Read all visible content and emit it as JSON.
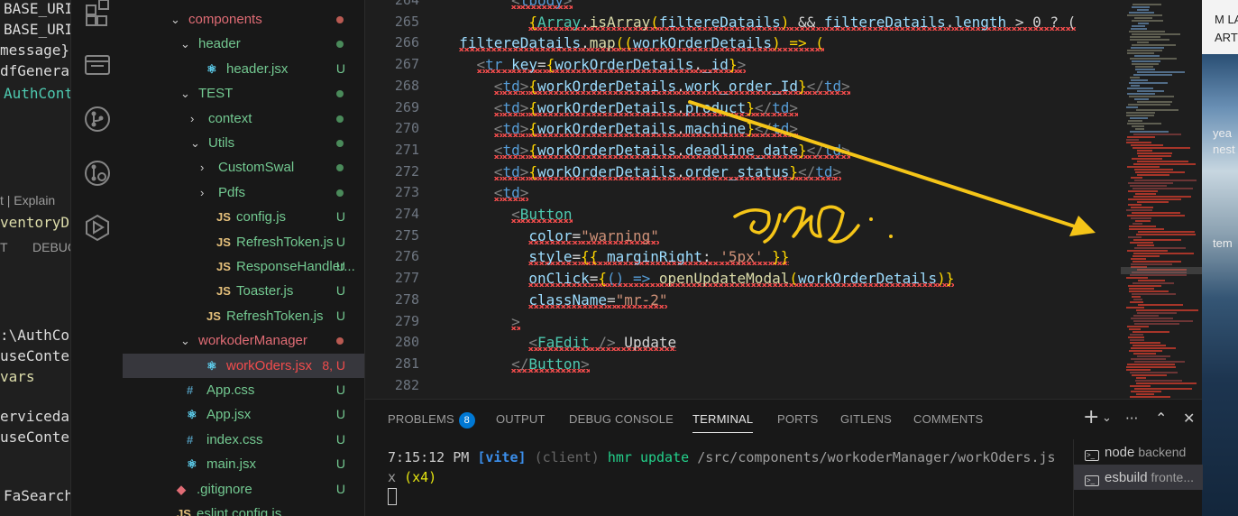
{
  "background_left": {
    "lines": [
      {
        "text": "BASE_URI",
        "color": "#dcdcdc"
      },
      {
        "text": "BASE_URI",
        "color": "#dcdcdc"
      },
      {
        "text": "message}",
        "color": "#dcdcdc"
      },
      {
        "text": "dfGenerat",
        "color": "#dcdcdc"
      },
      {
        "text": "AuthCont",
        "color": "#4ec9b0"
      },
      {
        "text": "t | Explain",
        "color": "#9d9d9d"
      },
      {
        "text": "ventoryDe",
        "color": "#dcdcaa"
      },
      {
        "text": "T",
        "color": "#9d9d9d"
      },
      {
        "text": "DEBUG",
        "color": "#9d9d9d"
      },
      {
        "text": ":\\AuthCon",
        "color": "#dcdcdc"
      },
      {
        "text": "useContex",
        "color": "#dcdcdc"
      },
      {
        "text": "vars",
        "color": "#dcdcaa"
      },
      {
        "text": "ervicedata",
        "color": "#dcdcdc"
      },
      {
        "text": "useConte",
        "color": "#dcdcdc"
      },
      {
        "text": "FaSearch",
        "color": "#dcdcdc"
      }
    ]
  },
  "activity_bar": {
    "icons": [
      "extensions-icon",
      "remote-explorer-icon",
      "source-control-icon",
      "git-graph-icon",
      "live-share-icon"
    ]
  },
  "explorer": {
    "rows": [
      {
        "name": "components",
        "type": "folder",
        "open": true,
        "depth": 1,
        "color": "#e06c75",
        "status": "dot",
        "status_color": "#b95a52"
      },
      {
        "name": "header",
        "type": "folder",
        "open": true,
        "depth": 2,
        "color": "#73c991",
        "status": "dot",
        "status_color": "#4a8a5a"
      },
      {
        "name": "header.jsx",
        "type": "jsx",
        "depth": 3,
        "color": "#73c991",
        "status": "U"
      },
      {
        "name": "TEST",
        "type": "folder",
        "open": true,
        "depth": 2,
        "color": "#73c991",
        "status": "dot",
        "status_color": "#4a8a5a"
      },
      {
        "name": "context",
        "type": "folder",
        "open": false,
        "depth": 3,
        "color": "#73c991",
        "status": "dot",
        "status_color": "#4a8a5a"
      },
      {
        "name": "Utils",
        "type": "folder",
        "open": true,
        "depth": 3,
        "color": "#73c991",
        "status": "dot",
        "status_color": "#4a8a5a"
      },
      {
        "name": "CustomSwal",
        "type": "folder",
        "open": false,
        "depth": 4,
        "color": "#73c991",
        "status": "dot",
        "status_color": "#4a8a5a"
      },
      {
        "name": "Pdfs",
        "type": "folder",
        "open": false,
        "depth": 4,
        "color": "#73c991",
        "status": "dot",
        "status_color": "#4a8a5a"
      },
      {
        "name": "config.js",
        "type": "js",
        "depth": 4,
        "color": "#73c991",
        "status": "U"
      },
      {
        "name": "RefreshToken.js",
        "type": "js",
        "depth": 4,
        "color": "#73c991",
        "status": "U"
      },
      {
        "name": "ResponseHandler...",
        "type": "js",
        "depth": 4,
        "color": "#73c991",
        "status": "U"
      },
      {
        "name": "Toaster.js",
        "type": "js",
        "depth": 4,
        "color": "#73c991",
        "status": "U"
      },
      {
        "name": "RefreshToken.js",
        "type": "js",
        "depth": 3,
        "color": "#73c991",
        "status": "U"
      },
      {
        "name": "workoderManager",
        "type": "folder",
        "open": true,
        "depth": 2,
        "color": "#e06c75",
        "status": "dot",
        "status_color": "#b95a52"
      },
      {
        "name": "workOders.jsx",
        "type": "jsx",
        "depth": 3,
        "color": "#f14c4c",
        "status": "8, U",
        "status_color": "#f14c4c",
        "selected": true
      },
      {
        "name": "App.css",
        "type": "css",
        "depth": 1,
        "color": "#73c991",
        "status": "U"
      },
      {
        "name": "App.jsx",
        "type": "jsx",
        "depth": 1,
        "color": "#73c991",
        "status": "U"
      },
      {
        "name": "index.css",
        "type": "css",
        "depth": 1,
        "color": "#73c991",
        "status": "U"
      },
      {
        "name": "main.jsx",
        "type": "jsx",
        "depth": 1,
        "color": "#73c991",
        "status": "U"
      },
      {
        "name": ".gitignore",
        "type": "git",
        "depth": 0,
        "color": "#73c991",
        "status": "U"
      },
      {
        "name": "eslint.config.js",
        "type": "js",
        "depth": 0,
        "color": "#73c991",
        "status": ""
      }
    ]
  },
  "editor": {
    "line_numbers": [
      "264",
      "265",
      "266",
      "267",
      "268",
      "269",
      "270",
      "271",
      "272",
      "273",
      "274",
      "275",
      "276",
      "277",
      "278",
      "279",
      "280",
      "281",
      "282"
    ],
    "lines": [
      [
        {
          "t": "        ",
          "c": "k-txt"
        },
        {
          "t": "<",
          "c": "k-punc"
        },
        {
          "t": "tbody",
          "c": "k-tag"
        },
        {
          "t": ">",
          "c": "k-punc"
        }
      ],
      [
        {
          "t": "          ",
          "c": "k-txt"
        },
        {
          "t": "{",
          "c": "k-brace"
        },
        {
          "t": "Array",
          "c": "k-comp"
        },
        {
          "t": ".",
          "c": "k-txt"
        },
        {
          "t": "isArray",
          "c": "k-fn"
        },
        {
          "t": "(",
          "c": "k-brace"
        },
        {
          "t": "filtereDatails",
          "c": "k-var"
        },
        {
          "t": ")",
          "c": "k-brace"
        },
        {
          "t": " && ",
          "c": "k-txt"
        },
        {
          "t": "filtereDatails",
          "c": "k-var"
        },
        {
          "t": ".",
          "c": "k-txt"
        },
        {
          "t": "length",
          "c": "k-prop"
        },
        {
          "t": " > 0 ? (",
          "c": "k-txt"
        }
      ],
      [
        {
          "t": "  ",
          "c": "k-txt"
        },
        {
          "t": "filtereDatails",
          "c": "k-var"
        },
        {
          "t": ".",
          "c": "k-txt"
        },
        {
          "t": "map",
          "c": "k-fn"
        },
        {
          "t": "((",
          "c": "k-brace"
        },
        {
          "t": "workOrderDetails",
          "c": "k-var"
        },
        {
          "t": ") => (",
          "c": "k-brace"
        }
      ],
      [
        {
          "t": "    ",
          "c": "k-txt"
        },
        {
          "t": "<",
          "c": "k-punc"
        },
        {
          "t": "tr",
          "c": "k-tag"
        },
        {
          "t": " ",
          "c": "k-txt"
        },
        {
          "t": "key",
          "c": "k-attr"
        },
        {
          "t": "=",
          "c": "k-txt"
        },
        {
          "t": "{",
          "c": "k-brace"
        },
        {
          "t": "workOrderDetails",
          "c": "k-var"
        },
        {
          "t": ".",
          "c": "k-txt"
        },
        {
          "t": "_id",
          "c": "k-prop"
        },
        {
          "t": "}",
          "c": "k-brace"
        },
        {
          "t": ">",
          "c": "k-punc"
        }
      ],
      [
        {
          "t": "      ",
          "c": "k-txt"
        },
        {
          "t": "<",
          "c": "k-punc"
        },
        {
          "t": "td",
          "c": "k-tag"
        },
        {
          "t": ">",
          "c": "k-punc"
        },
        {
          "t": "{",
          "c": "k-brace"
        },
        {
          "t": "workOrderDetails",
          "c": "k-var"
        },
        {
          "t": ".",
          "c": "k-txt"
        },
        {
          "t": "work_order_Id",
          "c": "k-prop"
        },
        {
          "t": "}",
          "c": "k-brace"
        },
        {
          "t": "</",
          "c": "k-punc"
        },
        {
          "t": "td",
          "c": "k-tag"
        },
        {
          "t": ">",
          "c": "k-punc"
        }
      ],
      [
        {
          "t": "      ",
          "c": "k-txt"
        },
        {
          "t": "<",
          "c": "k-punc"
        },
        {
          "t": "td",
          "c": "k-tag"
        },
        {
          "t": ">",
          "c": "k-punc"
        },
        {
          "t": "{",
          "c": "k-brace"
        },
        {
          "t": "workOrderDetails",
          "c": "k-var"
        },
        {
          "t": ".",
          "c": "k-txt"
        },
        {
          "t": "product",
          "c": "k-prop"
        },
        {
          "t": "}",
          "c": "k-brace"
        },
        {
          "t": "</",
          "c": "k-punc"
        },
        {
          "t": "td",
          "c": "k-tag"
        },
        {
          "t": ">",
          "c": "k-punc"
        }
      ],
      [
        {
          "t": "      ",
          "c": "k-txt"
        },
        {
          "t": "<",
          "c": "k-punc"
        },
        {
          "t": "td",
          "c": "k-tag"
        },
        {
          "t": ">",
          "c": "k-punc"
        },
        {
          "t": "{",
          "c": "k-brace"
        },
        {
          "t": "workOrderDetails",
          "c": "k-var"
        },
        {
          "t": ".",
          "c": "k-txt"
        },
        {
          "t": "machine",
          "c": "k-prop"
        },
        {
          "t": "}",
          "c": "k-brace"
        },
        {
          "t": "</",
          "c": "k-punc"
        },
        {
          "t": "td",
          "c": "k-tag"
        },
        {
          "t": ">",
          "c": "k-punc"
        }
      ],
      [
        {
          "t": "      ",
          "c": "k-txt"
        },
        {
          "t": "<",
          "c": "k-punc"
        },
        {
          "t": "td",
          "c": "k-tag"
        },
        {
          "t": ">",
          "c": "k-punc"
        },
        {
          "t": "{",
          "c": "k-brace"
        },
        {
          "t": "workOrderDetails",
          "c": "k-var"
        },
        {
          "t": ".",
          "c": "k-txt"
        },
        {
          "t": "deadline_date",
          "c": "k-prop"
        },
        {
          "t": "}",
          "c": "k-brace"
        },
        {
          "t": "</",
          "c": "k-punc"
        },
        {
          "t": "td",
          "c": "k-tag"
        },
        {
          "t": ">",
          "c": "k-punc"
        }
      ],
      [
        {
          "t": "      ",
          "c": "k-txt"
        },
        {
          "t": "<",
          "c": "k-punc"
        },
        {
          "t": "td",
          "c": "k-tag"
        },
        {
          "t": ">",
          "c": "k-punc"
        },
        {
          "t": "{",
          "c": "k-brace"
        },
        {
          "t": "workOrderDetails",
          "c": "k-var"
        },
        {
          "t": ".",
          "c": "k-txt"
        },
        {
          "t": "order_status",
          "c": "k-prop"
        },
        {
          "t": "}",
          "c": "k-brace"
        },
        {
          "t": "</",
          "c": "k-punc"
        },
        {
          "t": "td",
          "c": "k-tag"
        },
        {
          "t": ">",
          "c": "k-punc"
        }
      ],
      [
        {
          "t": "      ",
          "c": "k-txt"
        },
        {
          "t": "<",
          "c": "k-punc"
        },
        {
          "t": "td",
          "c": "k-tag"
        },
        {
          "t": ">",
          "c": "k-punc"
        }
      ],
      [
        {
          "t": "        ",
          "c": "k-txt"
        },
        {
          "t": "<",
          "c": "k-punc"
        },
        {
          "t": "Button",
          "c": "k-comp"
        }
      ],
      [
        {
          "t": "          ",
          "c": "k-txt"
        },
        {
          "t": "color",
          "c": "k-attr"
        },
        {
          "t": "=",
          "c": "k-txt"
        },
        {
          "t": "\"warning\"",
          "c": "k-str"
        }
      ],
      [
        {
          "t": "          ",
          "c": "k-txt"
        },
        {
          "t": "style",
          "c": "k-attr"
        },
        {
          "t": "=",
          "c": "k-txt"
        },
        {
          "t": "{{",
          "c": "k-brace"
        },
        {
          "t": " ",
          "c": "k-txt"
        },
        {
          "t": "marginRight",
          "c": "k-prop"
        },
        {
          "t": ": ",
          "c": "k-txt"
        },
        {
          "t": "'5px'",
          "c": "k-str"
        },
        {
          "t": " ",
          "c": "k-txt"
        },
        {
          "t": "}}",
          "c": "k-brace"
        }
      ],
      [
        {
          "t": "          ",
          "c": "k-txt"
        },
        {
          "t": "onClick",
          "c": "k-attr"
        },
        {
          "t": "=",
          "c": "k-txt"
        },
        {
          "t": "{",
          "c": "k-brace"
        },
        {
          "t": "() => ",
          "c": "k-tag"
        },
        {
          "t": "openUpdateModal",
          "c": "k-fn"
        },
        {
          "t": "(",
          "c": "k-brace"
        },
        {
          "t": "workOrderDetails",
          "c": "k-var"
        },
        {
          "t": ")",
          "c": "k-brace"
        },
        {
          "t": "}",
          "c": "k-brace"
        }
      ],
      [
        {
          "t": "          ",
          "c": "k-txt"
        },
        {
          "t": "className",
          "c": "k-attr"
        },
        {
          "t": "=",
          "c": "k-txt"
        },
        {
          "t": "\"mr-2\"",
          "c": "k-str"
        }
      ],
      [
        {
          "t": "        ",
          "c": "k-txt"
        },
        {
          "t": ">",
          "c": "k-punc"
        }
      ],
      [
        {
          "t": "          ",
          "c": "k-txt"
        },
        {
          "t": "<",
          "c": "k-punc"
        },
        {
          "t": "FaEdit",
          "c": "k-comp"
        },
        {
          "t": " />",
          "c": "k-punc"
        },
        {
          "t": " Update",
          "c": "k-txt"
        }
      ],
      [
        {
          "t": "        ",
          "c": "k-txt"
        },
        {
          "t": "</",
          "c": "k-punc"
        },
        {
          "t": "Button",
          "c": "k-comp"
        },
        {
          "t": ">",
          "c": "k-punc"
        }
      ],
      [
        {
          "t": "",
          "c": "k-txt"
        }
      ]
    ]
  },
  "right_background": {
    "texts": [
      {
        "text": "M LA",
        "color": "#222222"
      },
      {
        "text": "ART",
        "color": "#222222"
      },
      {
        "text": "yea",
        "color": "#eeeeee"
      },
      {
        "text": "nest",
        "color": "#eeeeee"
      },
      {
        "text": "tem",
        "color": "#eeeeee"
      }
    ]
  },
  "panel": {
    "tabs": [
      "PROBLEMS",
      "OUTPUT",
      "DEBUG CONSOLE",
      "TERMINAL",
      "PORTS",
      "GITLENS",
      "COMMENTS"
    ],
    "problems_count": "8",
    "active_tab": "TERMINAL",
    "controls": [
      "+",
      "⌄",
      "···",
      "⌃",
      "✕"
    ],
    "terminal": {
      "time": "7:15:12 PM",
      "source": "[vite]",
      "scope": "(client)",
      "message": "hmr update",
      "path": "/src/components/workoderManager/workOders.js",
      "wrap": "x",
      "count": "(x4)"
    },
    "terminals": [
      {
        "name": "node",
        "sub": "backend",
        "selected": false
      },
      {
        "name": "esbuild",
        "sub": "fronte...",
        "selected": true
      }
    ]
  },
  "annotation": {
    "color": "#f5c518"
  }
}
